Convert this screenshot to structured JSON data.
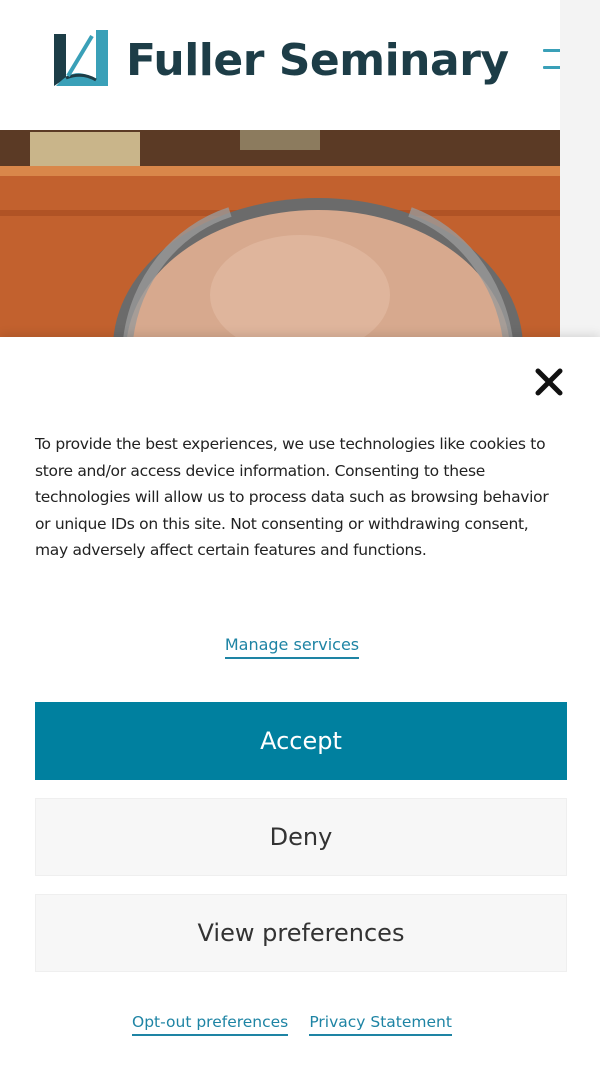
{
  "header": {
    "logo_text": "Fuller Seminary",
    "logo_icon": "book-logo-icon",
    "menu_icon": "hamburger-menu-icon"
  },
  "hero": {
    "image": "portrait-photo"
  },
  "cookie_banner": {
    "close_icon": "close-icon",
    "message": "To provide the best experiences, we use technologies like cookies to store and/or access device information. Consenting to these technologies will allow us to process data such as browsing behavior or unique IDs on this site. Not consenting or withdrawing consent, may adversely affect certain features and functions.",
    "manage_services_label": "Manage services",
    "accept_label": "Accept",
    "deny_label": "Deny",
    "view_preferences_label": "View preferences",
    "opt_out_label": "Opt-out preferences",
    "privacy_statement_label": "Privacy Statement"
  },
  "colors": {
    "brand_dark": "#1d3d47",
    "accent_teal": "#00809f",
    "link_teal": "#1e84a4",
    "menu_teal": "#3aa0b8"
  }
}
